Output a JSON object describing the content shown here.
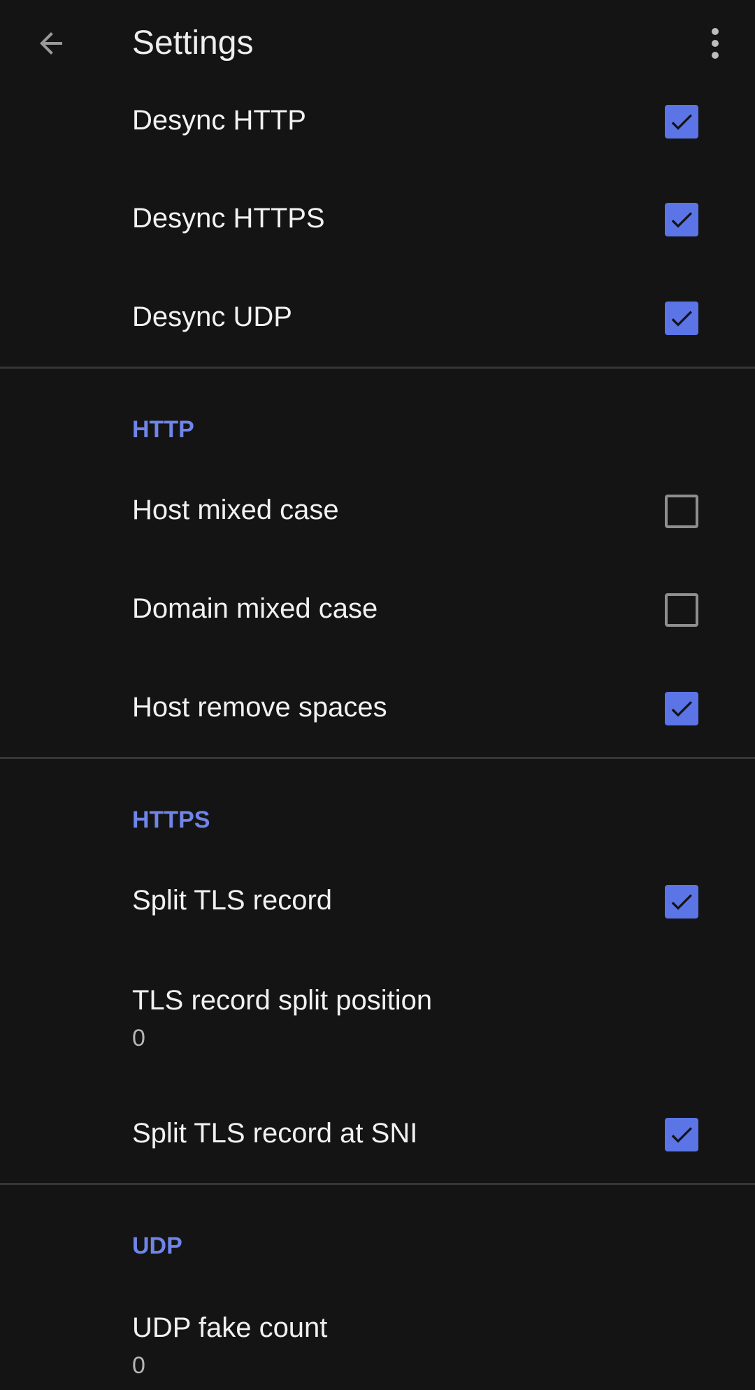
{
  "app_bar": {
    "title": "Settings",
    "back_icon": "arrow-left-icon",
    "menu_icon": "more-vert-icon"
  },
  "colors": {
    "background": "#141415",
    "accent": "#5b75e6",
    "section_header": "#6f85e8",
    "divider": "#363638"
  },
  "desync": {
    "items": [
      {
        "label": "Desync HTTP",
        "checked": true
      },
      {
        "label": "Desync HTTPS",
        "checked": true
      },
      {
        "label": "Desync UDP",
        "checked": true
      }
    ]
  },
  "http": {
    "header": "HTTP",
    "items": [
      {
        "label": "Host mixed case",
        "checked": false
      },
      {
        "label": "Domain mixed case",
        "checked": false
      },
      {
        "label": "Host remove spaces",
        "checked": true
      }
    ]
  },
  "https": {
    "header": "HTTPS",
    "split_tls_record": {
      "label": "Split TLS record",
      "checked": true
    },
    "tls_split_position": {
      "label": "TLS record split position",
      "value": "0"
    },
    "split_at_sni": {
      "label": "Split TLS record at SNI",
      "checked": true
    }
  },
  "udp": {
    "header": "UDP",
    "fake_count": {
      "label": "UDP fake count",
      "value": "0"
    }
  }
}
